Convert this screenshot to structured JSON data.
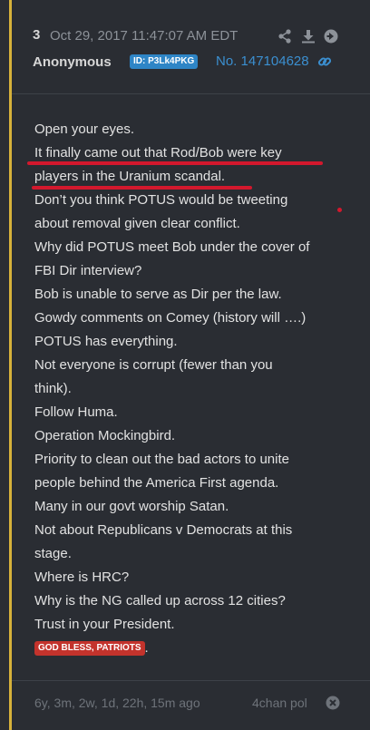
{
  "post": {
    "number": "3",
    "date": "Oct 29, 2017 11:47:07 AM EDT",
    "author": "Anonymous",
    "id_badge": "ID: P3Lk4PKG",
    "post_ref": "No. 147104628",
    "icons": {
      "share": "share-icon",
      "download": "download-icon",
      "goto": "arrow-right-circle-icon",
      "link": "link-icon",
      "close": "close-circle-icon"
    },
    "lines": [
      "Open your eyes.",
      "It finally came out that Rod/Bob were key",
      "players in the Uranium scandal.",
      "Don’t you think POTUS would be tweeting",
      "about removal given clear conflict.",
      "Why did POTUS meet Bob under the cover of",
      "FBI Dir interview?",
      "Bob is unable to serve as Dir per the law.",
      "Gowdy comments on Comey (history will ….)",
      "POTUS has everything.",
      "Not everyone is corrupt (fewer than you",
      "think).",
      "Follow Huma.",
      "Operation Mockingbird.",
      "Priority to clean out the bad actors to unite",
      "people behind the America First agenda.",
      "Many in our govt worship Satan.",
      "Not about Republicans v Democrats at this",
      "stage.",
      "Where is HRC?",
      "Why is the NG called up across 12 cities?",
      "Trust in your President."
    ],
    "closing_badge": "GOD BLESS, PATRIOTS",
    "closing_punct": ".",
    "relative_time": "6y, 3m, 2w, 1d, 22h, 15m ago",
    "source": "4chan pol"
  },
  "colors": {
    "background": "#2a2d33",
    "accent": "#d6b13a",
    "link": "#3b8fd0",
    "id_badge": "#2e85c6",
    "badge_red": "#c3332c",
    "highlight_red": "#d3182d"
  }
}
